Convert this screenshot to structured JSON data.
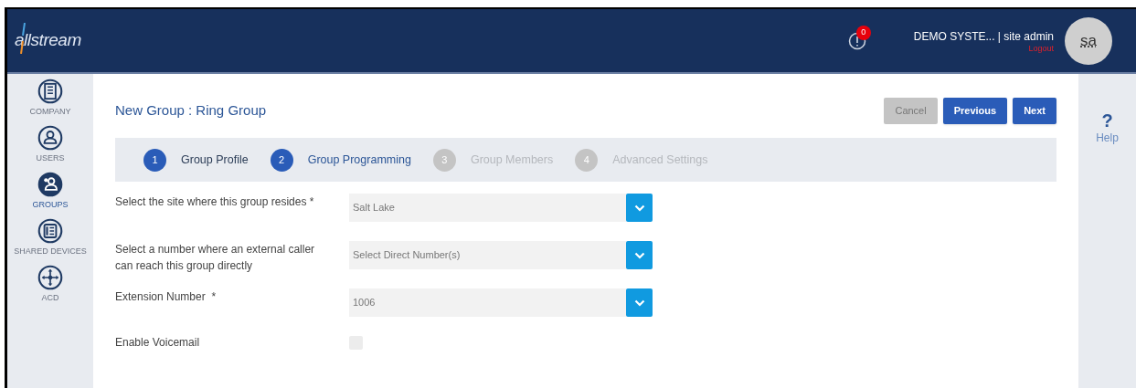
{
  "header": {
    "logo": "allstream",
    "alerts_badge": "0",
    "account": "DEMO SYSTE... | site admin",
    "logout": "Logout",
    "avatar": "sa"
  },
  "sidebar": {
    "items": [
      {
        "label": "COMPANY",
        "selected": false
      },
      {
        "label": "USERS",
        "selected": false
      },
      {
        "label": "GROUPS",
        "selected": true
      },
      {
        "label": "SHARED DEVICES",
        "selected": false
      },
      {
        "label": "ACD",
        "selected": false
      }
    ]
  },
  "page_title": "New Group : Ring Group",
  "buttons": [
    {
      "label": "Cancel",
      "disabled": true
    },
    {
      "label": "Previous",
      "disabled": false
    },
    {
      "label": "Next",
      "disabled": false
    }
  ],
  "steps": [
    {
      "number": "1",
      "label": "Group Profile",
      "kind": "done"
    },
    {
      "number": "2",
      "label": "Group Programming",
      "kind": "current"
    },
    {
      "number": "3",
      "label": "Group Members",
      "kind": "pending"
    },
    {
      "number": "4",
      "label": "Advanced Settings",
      "kind": "pending"
    }
  ],
  "fields": [
    {
      "kind": "select",
      "label": "Select the site where this group resides *",
      "value": "Salt Lake"
    },
    {
      "kind": "select",
      "label": "Select a number where an external caller can reach this group directly",
      "value": "Select Direct Number(s)"
    },
    {
      "kind": "select",
      "label": "Extension Number  *",
      "value": "1006"
    },
    {
      "kind": "checkbox",
      "label": "Enable Voicemail",
      "checked": false
    }
  ],
  "help": {
    "icon": "?",
    "label": "Help"
  }
}
